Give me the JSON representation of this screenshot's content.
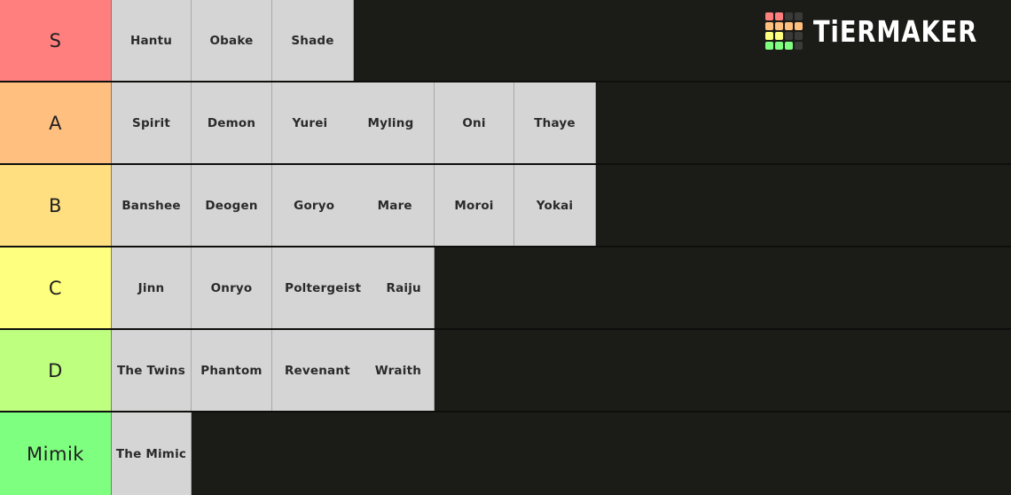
{
  "app": {
    "brand": "TiERMAKER",
    "background_color": "#1b1b18",
    "item_cell_color": "#d5d5d5"
  },
  "logo": {
    "name": "tiermaker-logo",
    "grid_colors": [
      [
        "#ff7f7f",
        "#ff7f7f",
        "#3a3a38",
        "#3a3a38"
      ],
      [
        "#ffbf7f",
        "#ffbf7f",
        "#ffbf7f",
        "#ffbf7f"
      ],
      [
        "#ffff7f",
        "#ffff7f",
        "#3a3a38",
        "#3a3a38"
      ],
      [
        "#7fff7f",
        "#7fff7f",
        "#7fff7f",
        "#3a3a38"
      ]
    ]
  },
  "tiers": [
    {
      "label": "S",
      "color": "#ff7f7f",
      "items": [
        {
          "cells": [
            "Hantu"
          ],
          "width": 90
        },
        {
          "cells": [
            "Obake"
          ],
          "width": 91
        },
        {
          "cells": [
            "Shade"
          ],
          "width": 92
        }
      ]
    },
    {
      "label": "A",
      "color": "#ffbf7f",
      "items": [
        {
          "cells": [
            "Spirit"
          ],
          "width": 90
        },
        {
          "cells": [
            "Demon"
          ],
          "width": 91
        },
        {
          "cells": [
            "Yurei",
            "Myling"
          ],
          "width": 183
        },
        {
          "cells": [
            "Oni"
          ],
          "width": 90
        },
        {
          "cells": [
            "Thaye"
          ],
          "width": 92
        }
      ]
    },
    {
      "label": "B",
      "color": "#ffdf7f",
      "items": [
        {
          "cells": [
            "Banshee"
          ],
          "width": 90
        },
        {
          "cells": [
            "Deogen"
          ],
          "width": 91
        },
        {
          "cells": [
            "Goryo",
            "Mare"
          ],
          "width": 183
        },
        {
          "cells": [
            "Moroi"
          ],
          "width": 90
        },
        {
          "cells": [
            "Yokai"
          ],
          "width": 92
        }
      ]
    },
    {
      "label": "C",
      "color": "#ffff7f",
      "items": [
        {
          "cells": [
            "Jinn"
          ],
          "width": 90
        },
        {
          "cells": [
            "Onryo"
          ],
          "width": 91
        },
        {
          "cells": [
            "Poltergeist",
            "Raiju"
          ],
          "width": 183
        }
      ]
    },
    {
      "label": "D",
      "color": "#bfff7f",
      "items": [
        {
          "cells": [
            "The Twins"
          ],
          "width": 90
        },
        {
          "cells": [
            "Phantom"
          ],
          "width": 91
        },
        {
          "cells": [
            "Revenant",
            "Wraith"
          ],
          "width": 183
        }
      ]
    },
    {
      "label": "Mimik",
      "color": "#7fff7f",
      "items": [
        {
          "cells": [
            "The Mimic"
          ],
          "width": 90
        }
      ]
    }
  ]
}
